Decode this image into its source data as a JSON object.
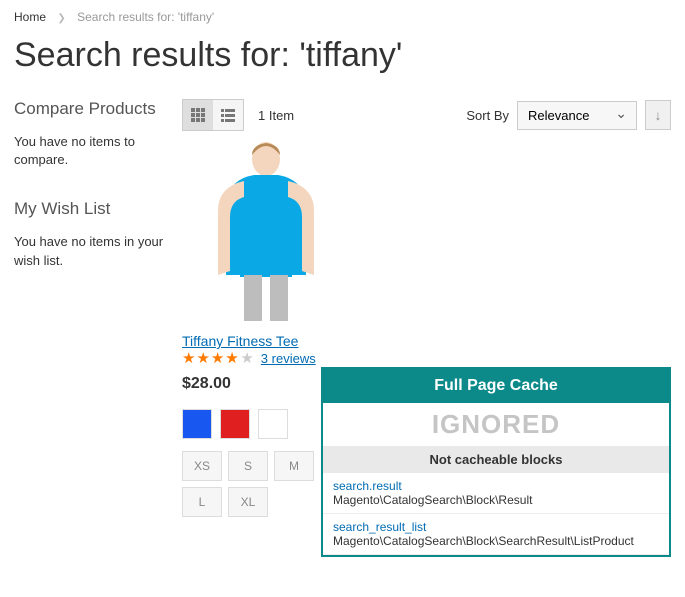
{
  "breadcrumbs": {
    "home": "Home",
    "current": "Search results for: 'tiffany'"
  },
  "page_title": "Search results for: 'tiffany'",
  "sidebar": {
    "compare_title": "Compare Products",
    "compare_empty": "You have no items to compare.",
    "wishlist_title": "My Wish List",
    "wishlist_empty": "You have no items in your wish list."
  },
  "toolbar": {
    "item_count": "1 Item",
    "sort_label": "Sort By",
    "sort_value": "Relevance"
  },
  "product": {
    "name": "Tiffany Fitness Tee",
    "reviews_text": "3 reviews",
    "price": "$28.00",
    "sizes": [
      "XS",
      "S",
      "M",
      "L",
      "XL"
    ]
  },
  "cache": {
    "title": "Full Page Cache",
    "status": "IGNORED",
    "subhead": "Not cacheable blocks",
    "blocks": [
      {
        "name": "search.result",
        "class": "Magento\\CatalogSearch\\Block\\Result"
      },
      {
        "name": "search_result_list",
        "class": "Magento\\CatalogSearch\\Block\\SearchResult\\ListProduct"
      }
    ]
  }
}
